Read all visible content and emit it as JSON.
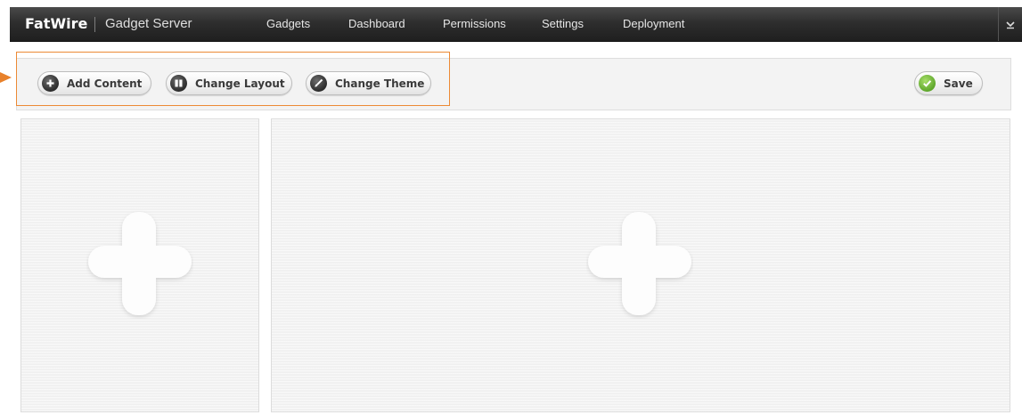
{
  "header": {
    "brand": "FatWire",
    "product": "Gadget Server",
    "nav": [
      "Gadgets",
      "Dashboard",
      "Permissions",
      "Settings",
      "Deployment"
    ]
  },
  "toolbar": {
    "add_content": "Add Content",
    "change_layout": "Change Layout",
    "change_theme": "Change Theme",
    "save": "Save"
  },
  "colors": {
    "highlight": "#ec8a35",
    "save_icon": "#6cb33f",
    "nav_background": "#2e2e2e"
  },
  "icons": {
    "add_content": "plus-circle-icon",
    "change_layout": "columns-icon",
    "change_theme": "brush-icon",
    "save": "checkmark-icon",
    "menu": "chevron-down-icon",
    "drop_zone": "plus-icon"
  }
}
